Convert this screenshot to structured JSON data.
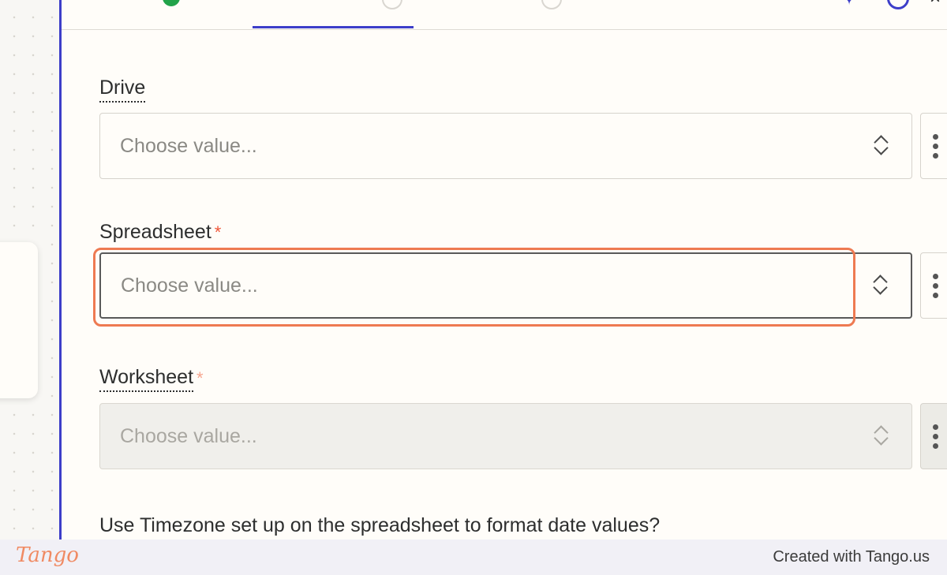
{
  "fields": [
    {
      "label": "Drive",
      "required": false,
      "placeholder": "Choose value..."
    },
    {
      "label": "Spreadsheet",
      "required": true,
      "placeholder": "Choose value..."
    },
    {
      "label": "Worksheet",
      "required": true,
      "placeholder": "Choose value..."
    }
  ],
  "required_mark": "*",
  "question": "Use Timezone set up on the spreadsheet to format date values?",
  "footer": {
    "brand": "Tango",
    "credit": "Created with Tango.us"
  },
  "colors": {
    "accent": "#3d3ec9",
    "highlight": "#ee7a52",
    "required": "#f0573a"
  }
}
